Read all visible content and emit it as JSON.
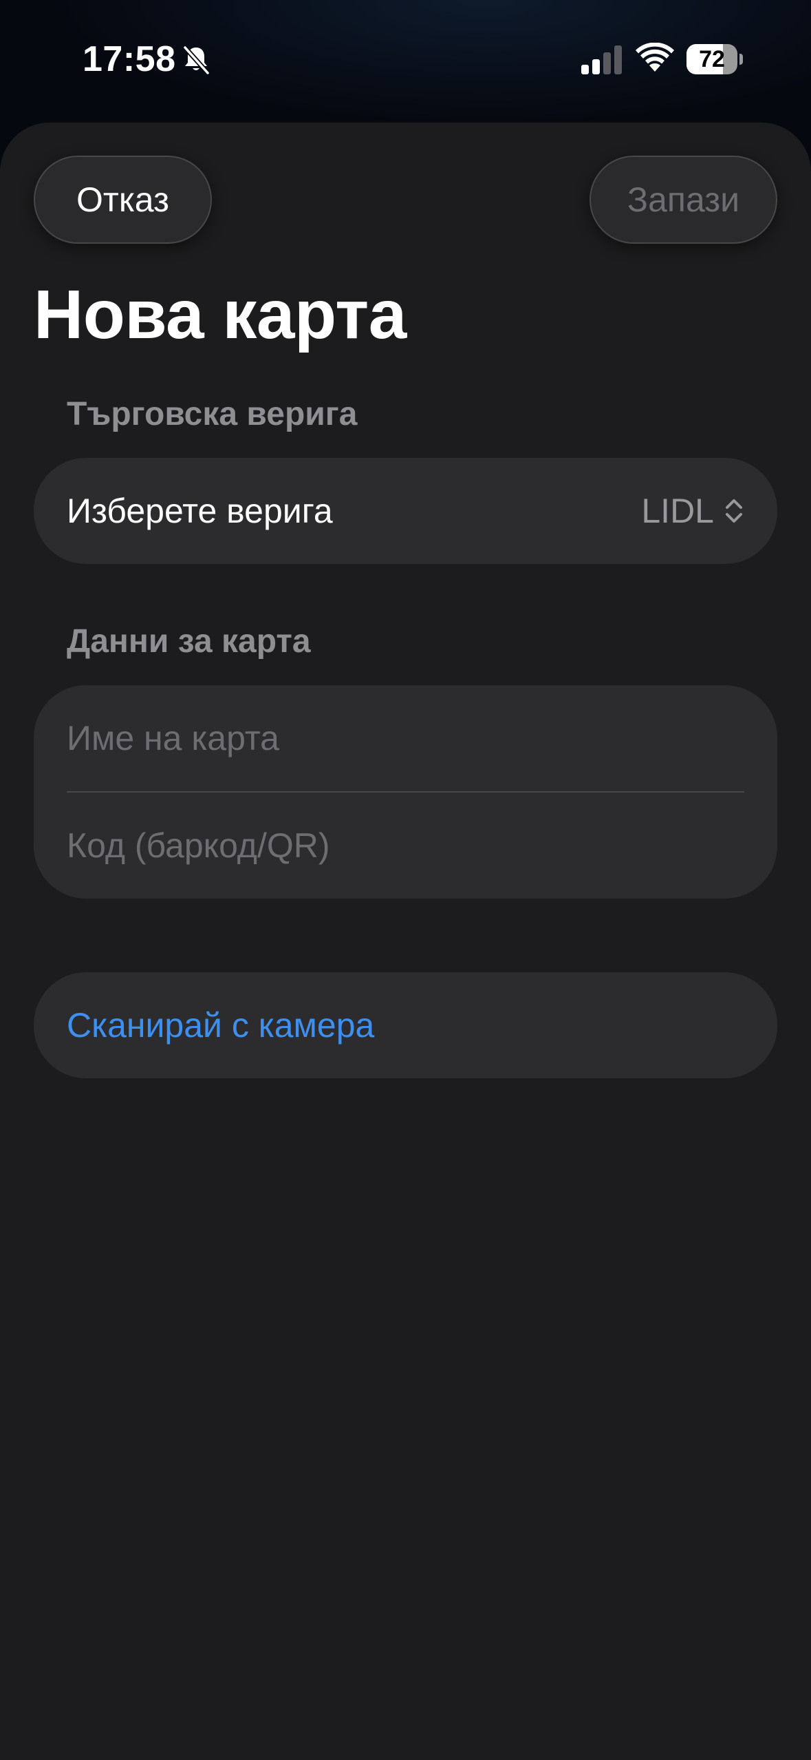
{
  "status_bar": {
    "time": "17:58",
    "silent_icon": "bell-slash-icon",
    "signal_icon": "cellular-signal-icon",
    "signal_bars_active": 2,
    "signal_bars_total": 4,
    "wifi_icon": "wifi-icon",
    "battery_level": "72",
    "battery_fraction": 0.72
  },
  "header": {
    "cancel_label": "Отказ",
    "save_label": "Запази",
    "title": "Нова карта"
  },
  "chain_section": {
    "header": "Търговска верига",
    "picker_label": "Изберете верига",
    "picker_value": "LIDL",
    "picker_icon": "chevron-up-down-icon"
  },
  "card_section": {
    "header": "Данни за карта",
    "name_field": {
      "value": "",
      "placeholder": "Име на карта"
    },
    "code_field": {
      "value": "",
      "placeholder": "Код (баркод/QR)"
    }
  },
  "scan": {
    "label": "Сканирай с камера"
  },
  "colors": {
    "background": "#1c1c1e",
    "group_background": "#2c2c2e",
    "accent": "#3d8ff0",
    "secondary_text": "#8e8e93"
  }
}
